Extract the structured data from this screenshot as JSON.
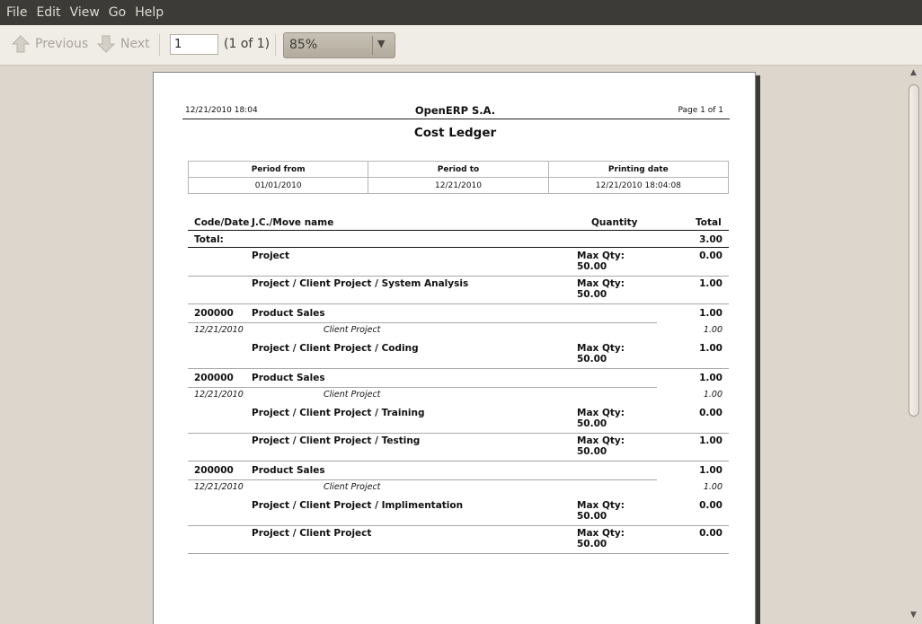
{
  "menubar": [
    "File",
    "Edit",
    "View",
    "Go",
    "Help"
  ],
  "toolbar": {
    "previous_label": "Previous",
    "next_label": "Next",
    "page_input_value": "1",
    "page_count": "(1 of 1)",
    "zoom_value": "85%",
    "colors": {
      "menubar_bg": "#3c3b37",
      "toolbar_bg": "#f0ece6",
      "viewer_bg": "#dcd6cc"
    }
  },
  "report": {
    "print_datetime": "12/21/2010  18:04",
    "company": "OpenERP S.A.",
    "page_label": "Page 1 of 1",
    "title": "Cost Ledger",
    "params": {
      "headers": [
        "Period from",
        "Period to",
        "Printing date"
      ],
      "values": [
        "01/01/2010",
        "12/21/2010",
        "12/21/2010 18:04:08"
      ]
    },
    "columns": {
      "code_date": "Code/Date",
      "jc_move": "J.C./Move name",
      "quantity": "Quantity",
      "total": "Total"
    },
    "total_row": {
      "label": "Total:",
      "value": "3.00"
    },
    "rows": [
      {
        "type": "account",
        "name": "Project",
        "qty_label": "Max Qty:",
        "qty_value": "50.00",
        "total": "0.00"
      },
      {
        "type": "account",
        "name": "Project / Client Project / System Analysis",
        "qty_label": "Max Qty:",
        "qty_value": "50.00",
        "total": "1.00"
      },
      {
        "type": "journal",
        "code": "200000",
        "name": "Product Sales",
        "total": "1.00"
      },
      {
        "type": "move",
        "date": "12/21/2010",
        "name": "Client Project",
        "total": "1.00"
      },
      {
        "type": "account",
        "name": "Project / Client Project / Coding",
        "qty_label": "Max Qty:",
        "qty_value": "50.00",
        "total": "1.00"
      },
      {
        "type": "journal",
        "code": "200000",
        "name": "Product Sales",
        "total": "1.00"
      },
      {
        "type": "move",
        "date": "12/21/2010",
        "name": "Client Project",
        "total": "1.00"
      },
      {
        "type": "account",
        "name": "Project / Client Project / Training",
        "qty_label": "Max Qty:",
        "qty_value": "50.00",
        "total": "0.00"
      },
      {
        "type": "account",
        "name": "Project / Client Project / Testing",
        "qty_label": "Max Qty:",
        "qty_value": "50.00",
        "total": "1.00"
      },
      {
        "type": "journal",
        "code": "200000",
        "name": "Product Sales",
        "total": "1.00"
      },
      {
        "type": "move",
        "date": "12/21/2010",
        "name": "Client Project",
        "total": "1.00"
      },
      {
        "type": "account",
        "name": "Project / Client Project / Implimentation",
        "qty_label": "Max Qty:",
        "qty_value": "50.00",
        "total": "0.00"
      },
      {
        "type": "account",
        "name": "Project / Client Project",
        "qty_label": "Max Qty:",
        "qty_value": "50.00",
        "total": "0.00"
      }
    ]
  }
}
